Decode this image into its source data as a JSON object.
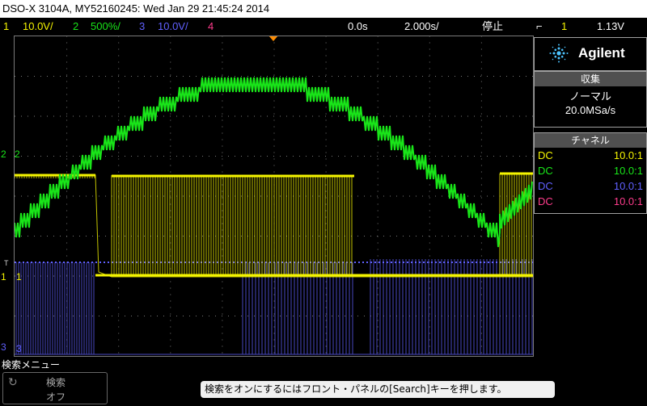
{
  "window_title": "DSO-X 3104A, MY52160245: Wed Jan 29 21:45:24 2014",
  "status": {
    "ch1_num": "1",
    "ch1_scale": "10.0V/",
    "ch2_num": "2",
    "ch2_scale": "500%/",
    "ch3_num": "3",
    "ch3_scale": "10.0V/",
    "ch4_num": "4",
    "time_delay": "0.0s",
    "time_scale": "2.000s/",
    "run_state": "停止",
    "trig_slope": "⮞",
    "trig_ch": "1",
    "trig_level": "1.13V"
  },
  "brand": "Agilent",
  "acquisition": {
    "header": "収集",
    "mode": "ノーマル",
    "sample_rate": "20.0MSa/s"
  },
  "channels": {
    "header": "チャネル",
    "rows": [
      {
        "coupling": "DC",
        "probe": "10.0:1"
      },
      {
        "coupling": "DC",
        "probe": "10.0:1"
      },
      {
        "coupling": "DC",
        "probe": "10.0:1"
      },
      {
        "coupling": "DC",
        "probe": "10.0:1"
      }
    ]
  },
  "markers": {
    "ch1": "1",
    "ch2": "2",
    "ch3": "3",
    "trig_t": "T"
  },
  "softkeys": {
    "title": "検索メニュー",
    "search_label": "検索",
    "search_value": "オフ"
  },
  "hint": "検索をオンにするにはフロント・パネルの[Search]キーを押します。",
  "colors": {
    "ch1": "#f5f500",
    "ch2": "#19e619",
    "ch3": "#6060ff",
    "ch4": "#ff3c8c"
  }
}
